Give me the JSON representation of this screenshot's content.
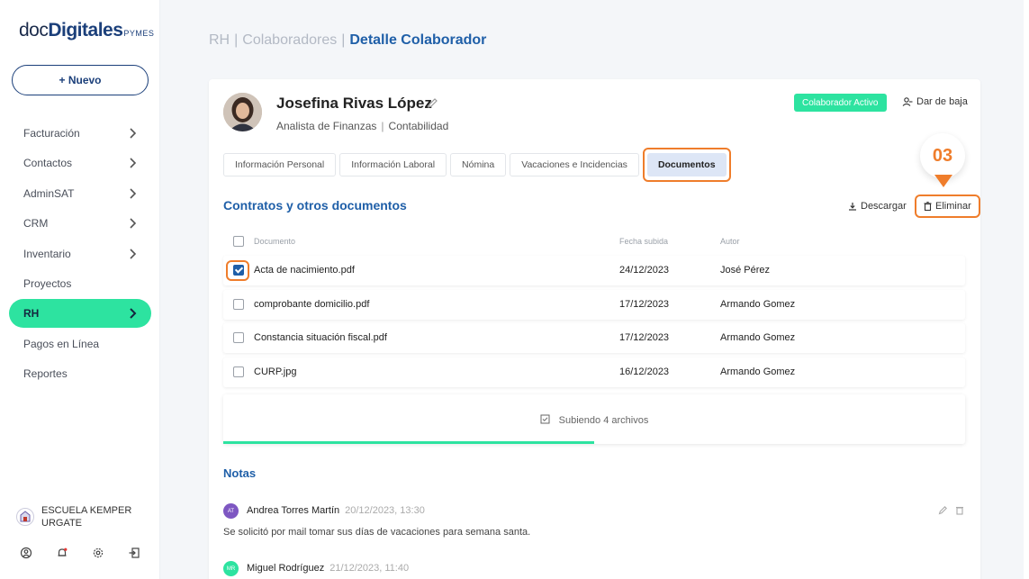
{
  "sidebar": {
    "logo": {
      "doc": "doc",
      "digitales": "Digitales",
      "pymes": "PYMES"
    },
    "new_button": "+ Nuevo",
    "items": [
      {
        "label": "Facturación",
        "chevron": true
      },
      {
        "label": "Contactos",
        "chevron": true
      },
      {
        "label": "AdminSAT",
        "chevron": true
      },
      {
        "label": "CRM",
        "chevron": true
      },
      {
        "label": "Inventario",
        "chevron": true
      },
      {
        "label": "Proyectos",
        "chevron": false
      },
      {
        "label": "RH",
        "chevron": true,
        "active": true
      },
      {
        "label": "Pagos en Línea",
        "chevron": false
      },
      {
        "label": "Reportes",
        "chevron": false
      }
    ],
    "org_name": "ESCUELA KEMPER URGATE",
    "bottom_icons": [
      "user-icon",
      "bell-icon",
      "settings-icon",
      "logout-icon"
    ]
  },
  "breadcrumb": {
    "part1": "RH",
    "part2": "Colaboradores",
    "current": "Detalle Colaborador",
    "separator": "|"
  },
  "employee": {
    "name": "Josefina Rivas López",
    "title": "Analista de Finanzas",
    "department": "Contabilidad",
    "status": "Colaborador Activo",
    "dismiss_label": "Dar de baja"
  },
  "tabs": [
    "Información Personal",
    "Información Laboral",
    "Nómina",
    "Vacaciones e Incidencias",
    "Documentos"
  ],
  "active_tab": "Documentos",
  "callout_step": "03",
  "documents": {
    "section_title": "Contratos y otros documentos",
    "download_label": "Descargar",
    "delete_label": "Eliminar",
    "columns": {
      "name": "Documento",
      "date": "Fecha subida",
      "author": "Autor"
    },
    "rows": [
      {
        "name": "Acta de nacimiento.pdf",
        "date": "24/12/2023",
        "author": "José Pérez",
        "checked": true
      },
      {
        "name": "comprobante domicilio.pdf",
        "date": "17/12/2023",
        "author": "Armando Gomez",
        "checked": false
      },
      {
        "name": "Constancia situación fiscal.pdf",
        "date": "17/12/2023",
        "author": "Armando Gomez",
        "checked": false
      },
      {
        "name": "CURP.jpg",
        "date": "16/12/2023",
        "author": "Armando Gomez",
        "checked": false
      }
    ],
    "upload_text": "Subiendo 4 archivos",
    "upload_progress": 0.5
  },
  "notes": {
    "title": "Notas",
    "items": [
      {
        "initials": "AT",
        "author": "Andrea Torres Martín",
        "date": "20/12/2023, 13:30",
        "text": "Se solicitó por mail tomar sus días de vacaciones para semana santa.",
        "color": "#7e57c2"
      },
      {
        "initials": "MR",
        "author": "Miguel Rodríguez",
        "date": "21/12/2023, 11:40",
        "text": "",
        "color": "#2de3a0"
      }
    ]
  },
  "colors": {
    "accent": "#2de3a0",
    "brand": "#1b3f7a",
    "link": "#1f5fa8",
    "highlight": "#ef7d2b"
  }
}
